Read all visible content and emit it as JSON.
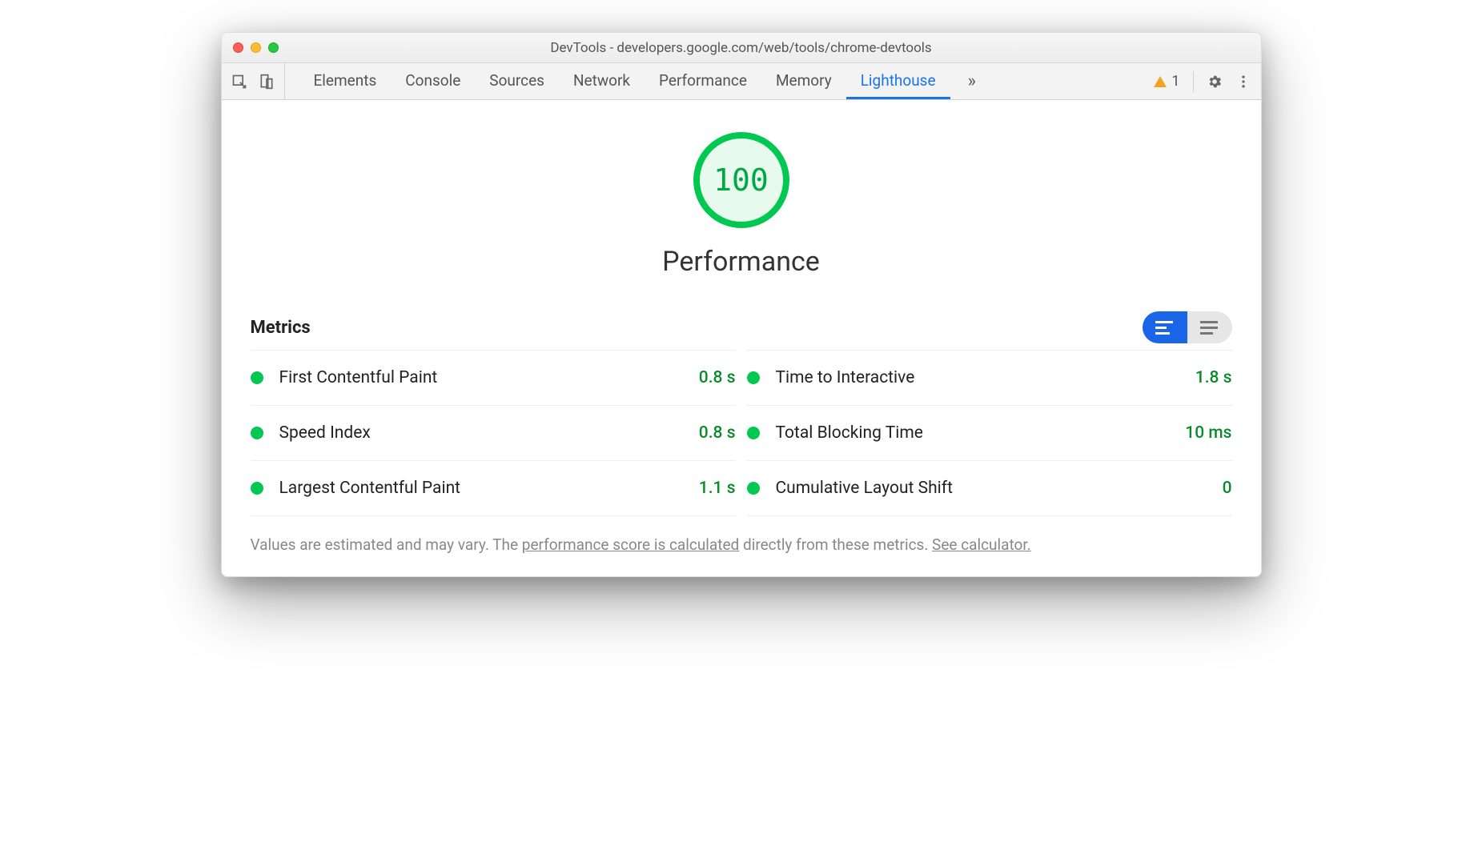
{
  "window": {
    "title": "DevTools - developers.google.com/web/tools/chrome-devtools"
  },
  "tabs": {
    "items": [
      "Elements",
      "Console",
      "Sources",
      "Network",
      "Performance",
      "Memory",
      "Lighthouse"
    ],
    "active_index": 6
  },
  "toolbar_right": {
    "warning_count": "1"
  },
  "lighthouse": {
    "score": "100",
    "category": "Performance",
    "metrics_heading": "Metrics",
    "metrics": [
      {
        "name": "First Contentful Paint",
        "value": "0.8 s",
        "status": "good"
      },
      {
        "name": "Time to Interactive",
        "value": "1.8 s",
        "status": "good"
      },
      {
        "name": "Speed Index",
        "value": "0.8 s",
        "status": "good"
      },
      {
        "name": "Total Blocking Time",
        "value": "10 ms",
        "status": "good"
      },
      {
        "name": "Largest Contentful Paint",
        "value": "1.1 s",
        "status": "good"
      },
      {
        "name": "Cumulative Layout Shift",
        "value": "0",
        "status": "good"
      }
    ],
    "footer": {
      "prefix": "Values are estimated and may vary. The ",
      "link1": "performance score is calculated",
      "mid": " directly from these metrics. ",
      "link2": "See calculator."
    }
  },
  "colors": {
    "good": "#00c851",
    "accent": "#1a73e8"
  }
}
